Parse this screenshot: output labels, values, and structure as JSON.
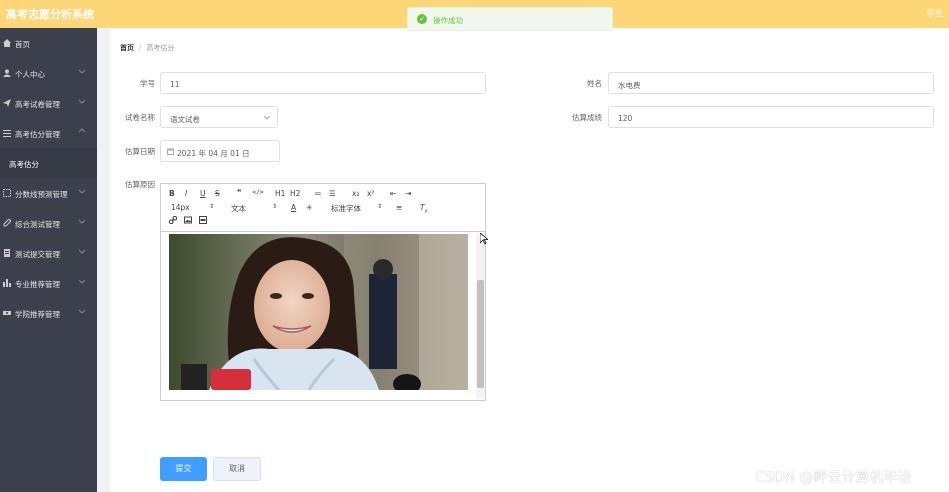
{
  "app": {
    "title": "高考志愿分析系统",
    "user_label": "学生"
  },
  "toast": {
    "message": "操作成功",
    "color": "#67c23a"
  },
  "sidebar": {
    "items": [
      {
        "label": "首页",
        "icon": "home-icon"
      },
      {
        "label": "个人中心",
        "icon": "user-icon"
      },
      {
        "label": "高考试卷管理",
        "icon": "send-icon"
      },
      {
        "label": "高考估分管理",
        "icon": "menu-icon"
      },
      {
        "label": "分数线预测管理",
        "icon": "dashed-box-icon"
      },
      {
        "label": "综合测试管理",
        "icon": "edit-icon"
      },
      {
        "label": "测试提交管理",
        "icon": "doc-icon"
      },
      {
        "label": "专业推荐管理",
        "icon": "bar-chart-icon"
      },
      {
        "label": "学院推荐管理",
        "icon": "ticket-icon"
      }
    ],
    "active_sub": "高考估分"
  },
  "breadcrumb": {
    "home": "首页",
    "current": "高考估分"
  },
  "form": {
    "student_id_label": "学号",
    "student_id_value": "11",
    "name_label": "姓名",
    "name_value": "水电费",
    "paper_label": "试卷名称",
    "paper_value": "语文试卷",
    "score_label": "估算成绩",
    "score_value": "120",
    "date_label": "估算日期",
    "date_value": "2021 年 04 月 01 日",
    "reason_label": "估算原因"
  },
  "editor": {
    "toolbar_row1": [
      "B",
      "I",
      "U",
      "S",
      "❞",
      "</>",
      "H1",
      "H2",
      "≔",
      "☰",
      "x₂",
      "x²",
      "⇤",
      "⇥"
    ],
    "font_size": "14px",
    "text_style": "文本",
    "font_family": "标准字体"
  },
  "buttons": {
    "submit": "提交",
    "cancel": "取消"
  },
  "watermark": "CSDN @畔云计算机毕设",
  "colors": {
    "topbar": "#fdd677",
    "sidebar": "#3b404c",
    "primary": "#409eff"
  }
}
